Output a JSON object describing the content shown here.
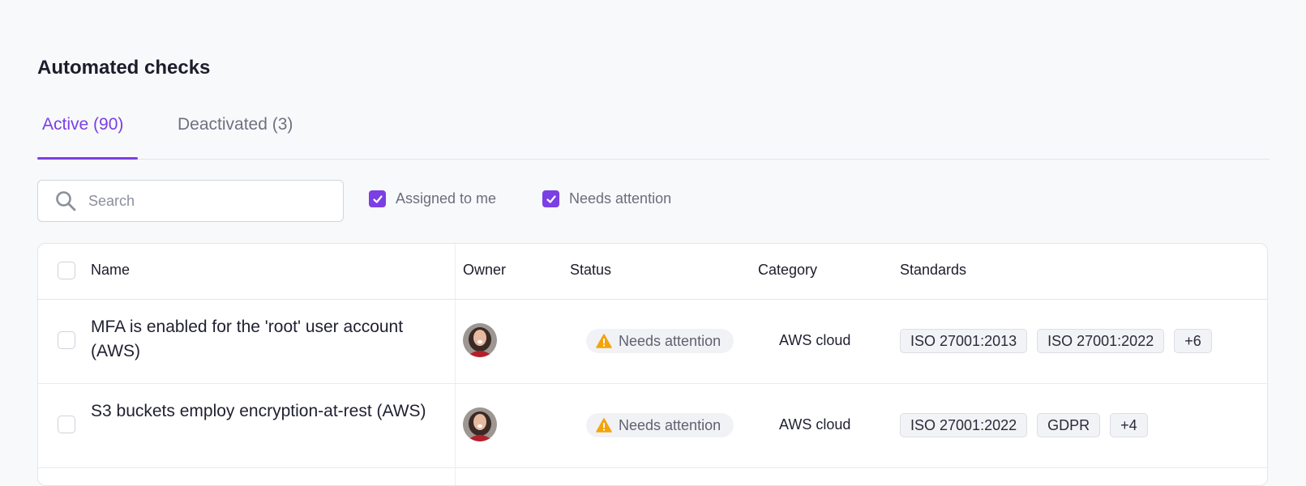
{
  "page": {
    "title": "Automated checks"
  },
  "tabs": [
    {
      "label": "Active (90)",
      "active": true
    },
    {
      "label": "Deactivated (3)",
      "active": false
    }
  ],
  "search": {
    "placeholder": "Search",
    "value": ""
  },
  "filters": [
    {
      "label": "Assigned to me",
      "checked": true
    },
    {
      "label": "Needs attention",
      "checked": true
    }
  ],
  "table": {
    "columns": [
      "Name",
      "Owner",
      "Status",
      "Category",
      "Standards"
    ],
    "rows": [
      {
        "name": "MFA is enabled for the 'root' user account (AWS)",
        "owner_icon": "avatar",
        "status": "Needs attention",
        "category": "AWS cloud",
        "standards": [
          "ISO 27001:2013",
          "ISO 27001:2022",
          "+6"
        ]
      },
      {
        "name": "S3 buckets employ encryption-at-rest (AWS)",
        "owner_icon": "avatar",
        "status": "Needs attention",
        "category": "AWS cloud",
        "standards": [
          "ISO 27001:2022",
          "GDPR",
          "+4"
        ]
      }
    ]
  },
  "colors": {
    "accent": "#7b3fe4",
    "warning": "#f5a30b",
    "background": "#f8f9fb"
  }
}
